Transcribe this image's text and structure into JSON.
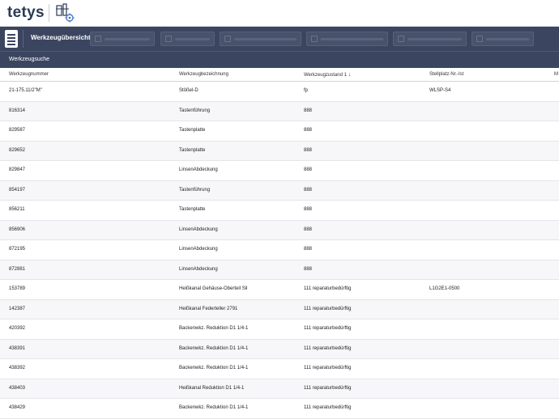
{
  "header": {
    "logo_text": "tetys",
    "app_icon": "machine-tool-gear-icon"
  },
  "toolbar": {
    "menu_icon": "list-menu-icon",
    "title": "Werkzeugübersicht",
    "buttons": [
      {
        "icon": "disabled-icon"
      },
      {
        "icon": "tools-icon"
      },
      {
        "icon": "image-icon"
      },
      {
        "icon": "document-icon"
      },
      {
        "icon": "document-icon"
      },
      {
        "icon": "copy-icon"
      }
    ]
  },
  "subbar": {
    "tab_label": "Werkzeugsuche"
  },
  "table": {
    "columns": [
      "Werkzeugnummer",
      "Werkzeugbezeichnung",
      "Werkzeugzustand 1",
      "Stellplatz-Nr.-Ist",
      "M"
    ],
    "sort_indicator": "↓",
    "rows": [
      [
        "21-175.11/2\"M\"",
        "Stößel-D",
        "fp",
        "WLSP-S4"
      ],
      [
        "816314",
        "Tastenführung",
        "888",
        ""
      ],
      [
        "829587",
        "Tastenplatte",
        "888",
        ""
      ],
      [
        "829652",
        "Tastenplatte",
        "888",
        ""
      ],
      [
        "829847",
        "LinsenAbdeckung",
        "888",
        ""
      ],
      [
        "854197",
        "Tastenführung",
        "888",
        ""
      ],
      [
        "856211",
        "Tastenplatte",
        "888",
        ""
      ],
      [
        "856906",
        "LinsenAbdeckung",
        "888",
        ""
      ],
      [
        "872195",
        "LinsenAbdeckung",
        "888",
        ""
      ],
      [
        "872881",
        "LinsenAbdeckung",
        "888",
        ""
      ],
      [
        "153789",
        "Heißkanal Gehäuse-Oberteil Sil",
        "111 reparaturbedürftig",
        "L1G2E1-0500"
      ],
      [
        "142387",
        "Heißkanal Federteller 2791",
        "111 reparaturbedürftig",
        ""
      ],
      [
        "420392",
        "Backenwkz. Reduktion D1 1/4-1",
        "111 reparaturbedürftig",
        ""
      ],
      [
        "438391",
        "Backenwkz. Reduktion D1 1/4-1",
        "111 reparaturbedürftig",
        ""
      ],
      [
        "438392",
        "Backenwkz. Reduktion D1 1/4-1",
        "111 reparaturbedürftig",
        ""
      ],
      [
        "438403",
        "Heißkanal Reduktion D1 1/4-1",
        "111 reparaturbedürftig",
        ""
      ],
      [
        "438429",
        "Backenwkz. Reduktion D1 1/4-1",
        "111 reparaturbedürftig",
        ""
      ]
    ]
  }
}
